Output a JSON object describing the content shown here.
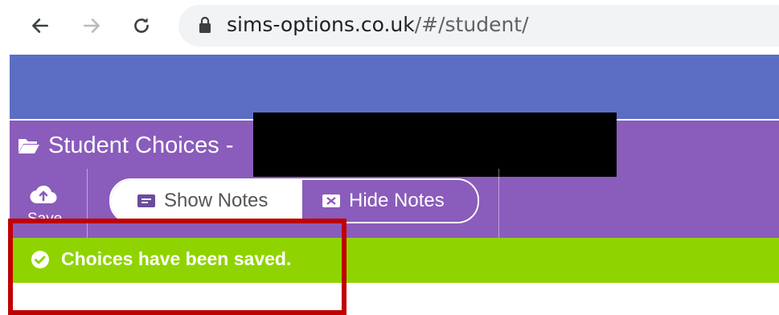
{
  "browser": {
    "url_domain": "sims-options.co.uk",
    "url_path": "/#/student/",
    "icons": [
      "back-arrow-icon",
      "forward-arrow-icon",
      "reload-icon",
      "lock-icon"
    ]
  },
  "app": {
    "page_title": "Student Choices -",
    "title_icon": "folder-open-icon",
    "save_label": "Save",
    "show_notes_label": "Show Notes",
    "hide_notes_label": "Hide Notes",
    "active_toggle": "Hide Notes"
  },
  "alert": {
    "message": "Choices have been saved.",
    "icon": "check-circle-icon"
  },
  "colors": {
    "header_blue": "#5c6ec4",
    "header_purple": "#8a5cbb",
    "success_green": "#8fd400",
    "highlight_red": "#c00000"
  }
}
